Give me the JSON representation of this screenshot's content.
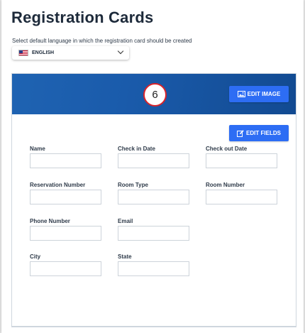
{
  "page": {
    "title": "Registration Cards"
  },
  "language": {
    "label": "Select default language in which the registration card should be created",
    "selected": "ENGLISH",
    "flag_icon": "us-flag-icon"
  },
  "card": {
    "step_badge": "6",
    "edit_image_label": "EDIT IMAGE",
    "edit_fields_label": "EDIT FIELDS",
    "fields": [
      {
        "label": "Name"
      },
      {
        "label": "Check in Date"
      },
      {
        "label": "Check out Date"
      },
      {
        "label": "Reservation Number"
      },
      {
        "label": "Room Type"
      },
      {
        "label": "Room Number"
      },
      {
        "label": "Phone Number"
      },
      {
        "label": "Email"
      },
      {
        "label": "City"
      },
      {
        "label": "State"
      }
    ]
  },
  "colors": {
    "accent": "#2d6df4",
    "banner": "#1a5bab",
    "badge_border": "#d9232a",
    "title": "#1d2a3a"
  }
}
